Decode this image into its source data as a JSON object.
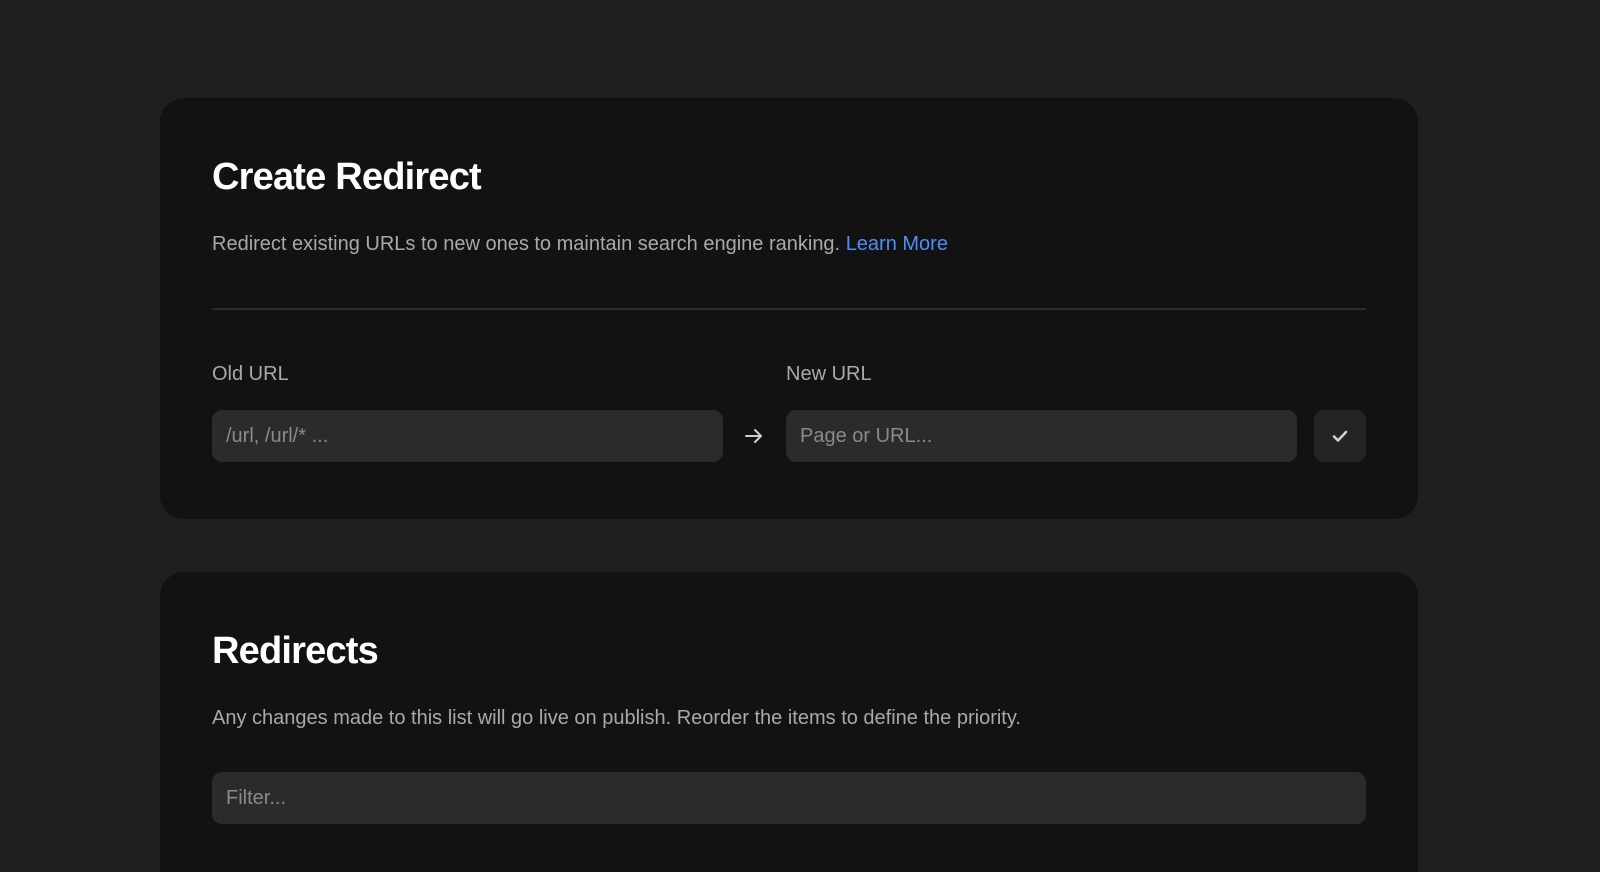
{
  "create_redirect": {
    "title": "Create Redirect",
    "description": "Redirect existing URLs to new ones to maintain search engine ranking.",
    "learn_more_label": "Learn More",
    "old_url": {
      "label": "Old URL",
      "placeholder": "/url, /url/* ...",
      "value": ""
    },
    "new_url": {
      "label": "New URL",
      "placeholder": "Page or URL...",
      "value": ""
    },
    "arrow_icon": "arrow-right-icon",
    "confirm_icon": "check-icon"
  },
  "redirects": {
    "title": "Redirects",
    "description": "Any changes made to this list will go live on publish. Reorder the items to define the priority.",
    "filter": {
      "placeholder": "Filter...",
      "value": ""
    }
  },
  "colors": {
    "background": "#1f1f1f",
    "card": "#121212",
    "input": "#2b2b2b",
    "link": "#4d8ef7",
    "muted_text": "#a9a9a9"
  }
}
